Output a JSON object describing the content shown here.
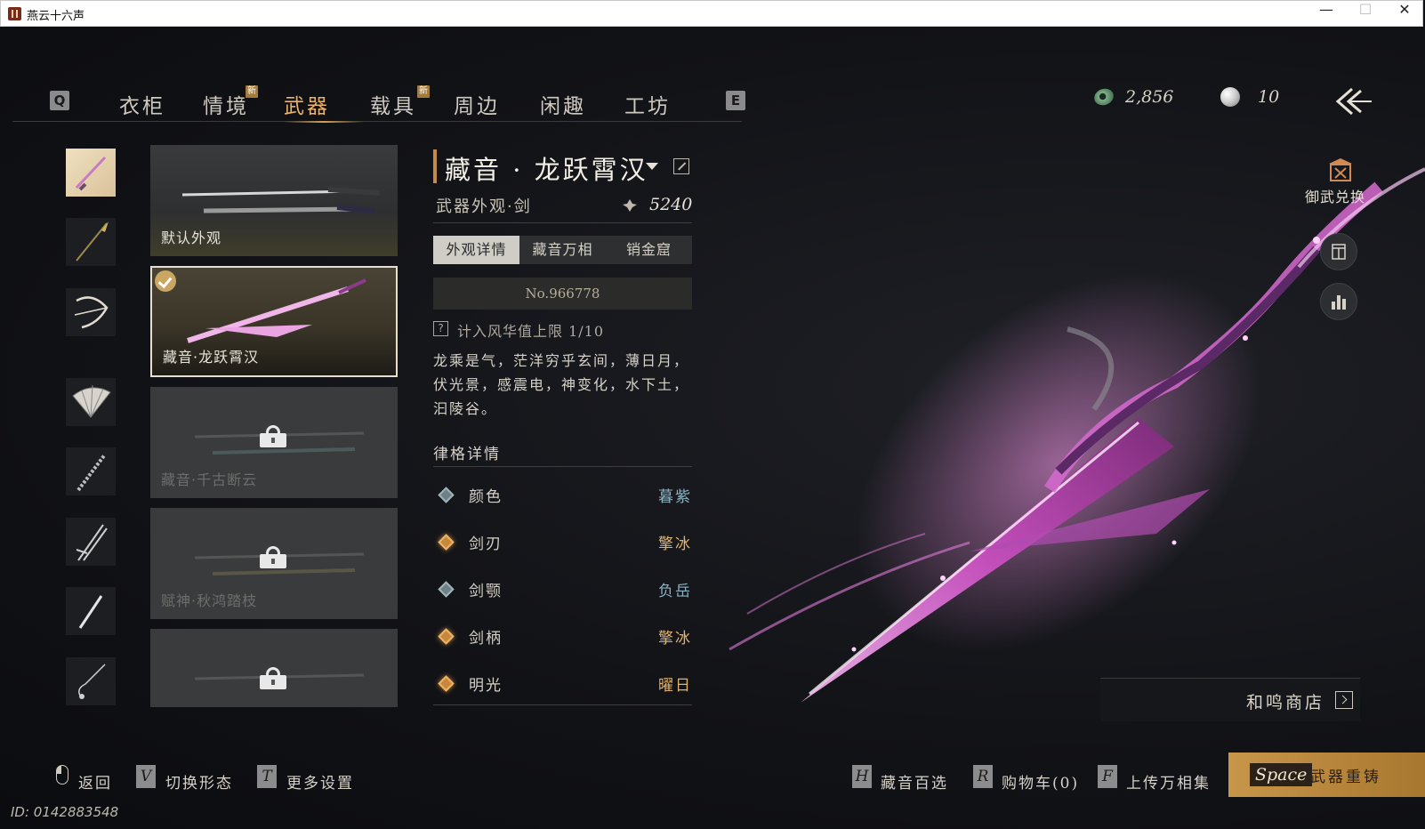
{
  "window": {
    "title": "燕云十六声",
    "minimize": "—",
    "maximize": "☐",
    "close": "✕"
  },
  "nav": {
    "prev_key": "Q",
    "next_key": "E",
    "tabs": [
      {
        "label": "衣柜",
        "active": false,
        "new": false
      },
      {
        "label": "情境",
        "active": false,
        "new": true
      },
      {
        "label": "武器",
        "active": true,
        "new": false
      },
      {
        "label": "载具",
        "active": false,
        "new": true
      },
      {
        "label": "周边",
        "active": false,
        "new": false
      },
      {
        "label": "闲趣",
        "active": false,
        "new": false
      },
      {
        "label": "工坊",
        "active": false,
        "new": false
      }
    ],
    "new_badge": "新"
  },
  "currency": {
    "jade": "2,856",
    "pearl": "10"
  },
  "side_categories": [
    "fan-sword",
    "spear",
    "bow",
    "fan",
    "umbrella",
    "twin-blades",
    "blade",
    "rope-dart"
  ],
  "skins": [
    {
      "label": "默认外观",
      "locked": false,
      "selected": false
    },
    {
      "label": "藏音·龙跃霄汉",
      "locked": false,
      "selected": true
    },
    {
      "label": "藏音·千古断云",
      "locked": true,
      "selected": false
    },
    {
      "label": "赋神·秋鸿踏枝",
      "locked": true,
      "selected": false
    },
    {
      "label": "",
      "locked": true,
      "selected": false
    }
  ],
  "detail": {
    "name": "藏音 · 龙跃霄汉",
    "subtitle": "武器外观·剑",
    "score": "5240",
    "subtabs": [
      "外观详情",
      "藏音万相",
      "销金窟"
    ],
    "active_subtab": 0,
    "serial": "No.966778",
    "fame": "计入风华值上限 1/10",
    "description": "龙乘是气，茫洋穷乎玄间，薄日月，伏光景，感震电，神变化，水下土，汩陵谷。",
    "section_title": "律格详情",
    "attributes": [
      {
        "name": "颜色",
        "value": "暮紫",
        "tier": "plain"
      },
      {
        "name": "剑刃",
        "value": "擎冰",
        "tier": "gold"
      },
      {
        "name": "剑颚",
        "value": "负岳",
        "tier": "plain"
      },
      {
        "name": "剑柄",
        "value": "擎冰",
        "tier": "gold"
      },
      {
        "name": "明光",
        "value": "曜日",
        "tier": "gold"
      }
    ]
  },
  "right_panel": {
    "exchange_label": "御武兑换",
    "shop_label": "和鸣商店"
  },
  "footer": {
    "back": "返回",
    "switch_key": "V",
    "switch_label": "切换形态",
    "settings_key": "T",
    "settings_label": "更多设置",
    "collection_key": "H",
    "collection_label": "藏音百选",
    "cart_key": "R",
    "cart_label": "购物车(0)",
    "upload_key": "F",
    "upload_label": "上传万相集",
    "recast_key": "Space",
    "recast_label": "武器重铸"
  },
  "uid": "ID: 0142883548",
  "colors": {
    "accent_gold": "#e8b36a",
    "attr_blue": "#8bb3c2",
    "glow_pink": "#e07bd8"
  }
}
